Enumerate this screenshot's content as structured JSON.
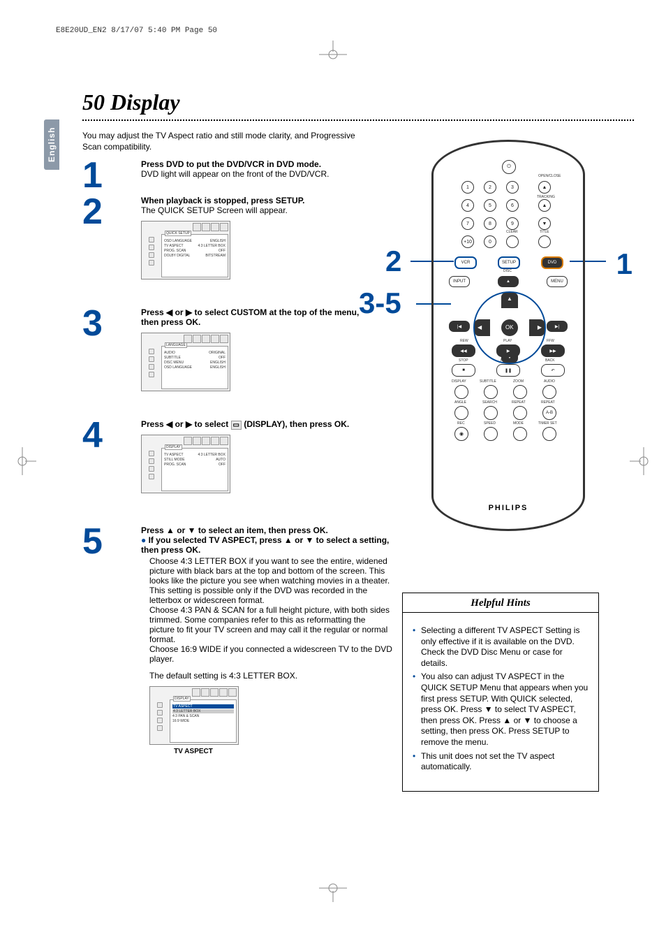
{
  "header": "E8E20UD_EN2  8/17/07  5:40 PM  Page 50",
  "lang_tab": "English",
  "title": "50   Display",
  "intro": "You may adjust the TV Aspect ratio and still mode clarity, and Progressive Scan compatibility.",
  "steps": {
    "s1": {
      "num": "1",
      "head": "Press DVD to put the DVD/VCR in DVD mode.",
      "text": "DVD light will appear on the front of the DVD/VCR."
    },
    "s2": {
      "num": "2",
      "head": "When playback is stopped, press SETUP.",
      "text": "The QUICK SETUP Screen will appear."
    },
    "s3": {
      "num": "3",
      "head_a": "Press ",
      "head_b": " or ",
      "head_c": " to select CUSTOM at the top of the menu, then press OK."
    },
    "s4": {
      "num": "4",
      "head_a": "Press ",
      "head_b": " or ",
      "head_c": " to select ",
      "head_d": " (DISPLAY), then press OK."
    },
    "s5": {
      "num": "5",
      "line1_a": "Press ",
      "line1_b": " or ",
      "line1_c": " to select an item, then press OK.",
      "line2_a": "If you selected TV ASPECT, press ",
      "line2_b": " or ",
      "line2_c": " to select a setting, then press OK.",
      "p1": "Choose 4:3 LETTER BOX if you want to see the entire, widened picture with black bars at the top and bottom of the screen. This looks like the picture you see when watching movies in a theater.  This setting is possible only if the DVD was recorded in the letterbox or widescreen format.",
      "p2": "Choose 4:3 PAN & SCAN for a full height picture, with both sides trimmed. Some companies refer to this as reformatting the picture to fit your TV screen and may call it the regular or normal format.",
      "p3": "Choose 16:9 WIDE if you connected a widescreen TV to the DVD player.",
      "p4": "The default setting is 4:3 LETTER BOX.",
      "caption": "TV ASPECT"
    }
  },
  "osd": {
    "quick": {
      "tab": "QUICK SETUP",
      "rows": [
        {
          "l": "OSD LANGUAGE",
          "r": "ENGLISH"
        },
        {
          "l": "TV ASPECT",
          "r": "4:3 LETTER BOX"
        },
        {
          "l": "PROG. SCAN",
          "r": "OFF"
        },
        {
          "l": "DOLBY DIGITAL",
          "r": "BITSTREAM"
        }
      ]
    },
    "language": {
      "tab": "LANGUAGE",
      "rows": [
        {
          "l": "AUDIO",
          "r": "ORIGINAL"
        },
        {
          "l": "SUBTITLE",
          "r": "OFF"
        },
        {
          "l": "DISC MENU",
          "r": "ENGLISH"
        },
        {
          "l": "OSD LANGUAGE",
          "r": "ENGLISH"
        }
      ]
    },
    "display": {
      "tab": "DISPLAY",
      "rows": [
        {
          "l": "TV ASPECT",
          "r": "4:3 LETTER BOX"
        },
        {
          "l": "STILL MODE",
          "r": "AUTO"
        },
        {
          "l": "PROG. SCAN",
          "r": "OFF"
        }
      ]
    },
    "tvaspect": {
      "tab": "DISPLAY",
      "sub": "TV ASPECT",
      "rows": [
        {
          "l": "4:3 LETTER BOX"
        },
        {
          "l": "4:3 PAN & SCAN"
        },
        {
          "l": "16:9 WIDE"
        }
      ]
    }
  },
  "remote": {
    "brand": "PHILIPS",
    "callouts": {
      "c1": "1",
      "c2": "2",
      "c35": "3-5"
    },
    "labels": {
      "openclose": "OPEN/CLOSE",
      "tracking": "TRACKING",
      "clear": "CLEAR",
      "title": "TITLE",
      "disc": "DISC",
      "input": "INPUT",
      "menu": "MENU",
      "ok": "OK",
      "rew": "REW",
      "play": "PLAY",
      "ffw": "FFW",
      "stop": "STOP",
      "pause": "PAUSE",
      "back": "BACK",
      "display": "DISPLAY",
      "subtitle": "SUBTITLE",
      "zoom": "ZOOM",
      "audio": "AUDIO",
      "angle": "ANGLE",
      "search": "SEARCH",
      "repeat": "REPEAT",
      "repeat2": "REPEAT",
      "rec": "REC",
      "speed": "SPEED",
      "mode": "MODE",
      "timerset": "TIMER SET",
      "ab": "A-B",
      "vcr": "VCR",
      "setup": "SETUP",
      "dvd": "DVD",
      "plus10": "+10",
      "k1": "1",
      "k2": "2",
      "k3": "3",
      "k4": "4",
      "k5": "5",
      "k6": "6",
      "k7": "7",
      "k8": "8",
      "k9": "9",
      "k0": "0"
    }
  },
  "hints": {
    "title": "Helpful Hints",
    "items": [
      "Selecting a different TV ASPECT Setting is only effective if it is available on the DVD. Check the DVD Disc Menu or case for details.",
      "You also can adjust TV ASPECT in the QUICK SETUP Menu that appears when you first press SETUP. With QUICK selected, press OK. Press ▼ to select TV ASPECT, then press OK. Press ▲ or ▼ to choose a setting, then press OK. Press SETUP to remove the menu.",
      "This unit does not set the TV aspect automatically."
    ]
  }
}
